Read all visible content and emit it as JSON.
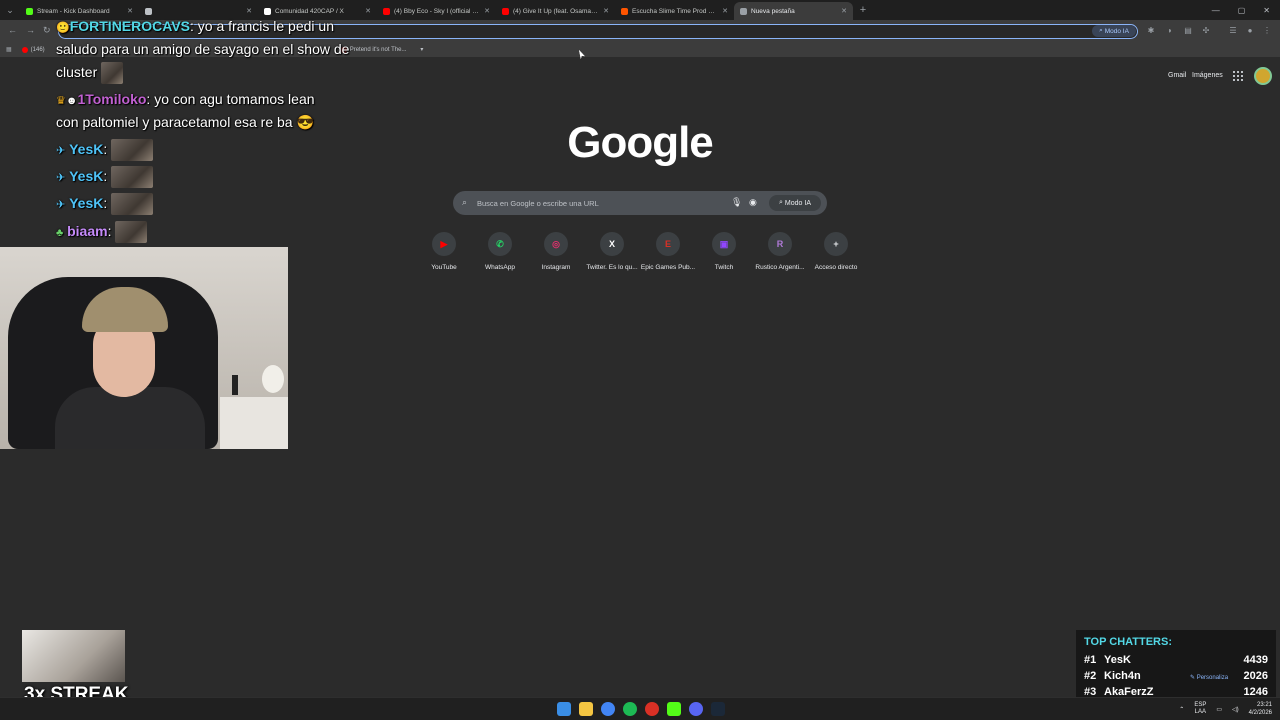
{
  "browser": {
    "tabs": [
      {
        "title": "Stream - Kick Dashboard",
        "color": "#53fc18",
        "active": false
      },
      {
        "title": "",
        "color": "#bdc1c6",
        "active": false
      },
      {
        "title": "Comunidad 420CAP / X",
        "color": "#ffffff",
        "active": false
      },
      {
        "title": "(4) Bby Eco - Sky I (official vide",
        "color": "#ff0000",
        "active": false
      },
      {
        "title": "(4) Give It Up (feat. OsamaSon)",
        "color": "#ff0000",
        "active": false
      },
      {
        "title": "Escucha Slime Time Prod Perc4",
        "color": "#ff5500",
        "active": false
      },
      {
        "title": "Nueva pestaña",
        "color": "#9aa0a6",
        "active": true
      }
    ],
    "ai_mode_label": "Modo IA",
    "bookmarks": [
      {
        "label": "(146)",
        "color": "#ff0000"
      },
      {
        "label": "Pretend it's not The...",
        "color": "#b03030"
      }
    ]
  },
  "google": {
    "gmail": "Gmail",
    "images": "Imágenes",
    "logo": "Google",
    "search_placeholder": "Busca en Google o escribe una URL",
    "ai_mode": "Modo IA",
    "shortcuts": [
      {
        "label": "YouTube",
        "glyph": "▶",
        "color": "#ff0000"
      },
      {
        "label": "WhatsApp",
        "glyph": "✆",
        "color": "#25d366"
      },
      {
        "label": "Instagram",
        "glyph": "◎",
        "color": "#e1306c"
      },
      {
        "label": "Twitter. Es lo qu...",
        "glyph": "X",
        "color": "#ffffff"
      },
      {
        "label": "Epic Games Pub...",
        "glyph": "E",
        "color": "#d93025"
      },
      {
        "label": "Twitch",
        "glyph": "▣",
        "color": "#9146ff"
      },
      {
        "label": "Rustico Argenti...",
        "glyph": "R",
        "color": "#b07ad8"
      },
      {
        "label": "Acceso directo",
        "glyph": "+",
        "color": "#e8eaed"
      }
    ]
  },
  "chat": [
    {
      "user": "FORTINEROCAVS",
      "color": "#53d8e6",
      "text": ": yo a francis le pedi un"
    },
    {
      "user": "",
      "color": "#ffffff",
      "text": "saludo para un amigo de sayago en el show de"
    },
    {
      "user": "",
      "color": "#ffffff",
      "text": "cluster"
    },
    {
      "user": "1Tomiloko",
      "color": "#c060d0",
      "text": ": yo con agu tomamos lean"
    },
    {
      "user": "",
      "color": "#ffffff",
      "text": "con paltomiel y paracetamol esa re ba"
    },
    {
      "user": "YesK",
      "color": "#4fc3f7",
      "text": ":"
    },
    {
      "user": "YesK",
      "color": "#4fc3f7",
      "text": ":"
    },
    {
      "user": "YesK",
      "color": "#4fc3f7",
      "text": ":"
    },
    {
      "user": "biaam",
      "color": "#c58af9",
      "text": ":"
    }
  ],
  "streak": "3x STREAK",
  "top_chatters": {
    "title": "TOP CHATTERS:",
    "rows": [
      {
        "rank": "#1",
        "name": "YesK",
        "count": "4439"
      },
      {
        "rank": "#2",
        "name": "Kich4n",
        "count": "2026"
      },
      {
        "rank": "#3",
        "name": "AkaFerzZ",
        "count": "1246"
      }
    ]
  },
  "personalizar": "Personaliza",
  "taskbar": {
    "lang": "ESP",
    "region": "LAA",
    "time": "23:21",
    "date": "4/2/2026"
  }
}
